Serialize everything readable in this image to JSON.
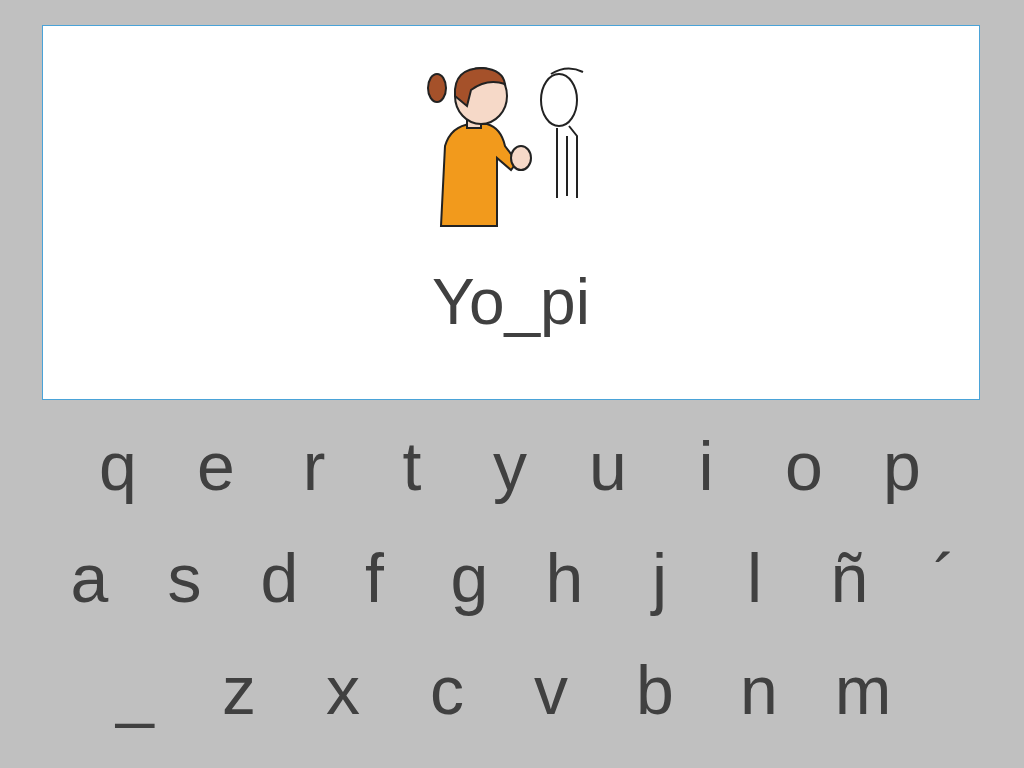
{
  "card": {
    "word": "Yo_pi"
  },
  "keyboard": {
    "rows": [
      [
        "q",
        "e",
        "r",
        "t",
        "y",
        "u",
        "i",
        "o",
        "p"
      ],
      [
        "a",
        "s",
        "d",
        "f",
        "g",
        "h",
        "j",
        "l",
        "ñ",
        "´"
      ],
      [
        "_",
        "z",
        "x",
        "c",
        "v",
        "b",
        "n",
        "m"
      ]
    ]
  }
}
